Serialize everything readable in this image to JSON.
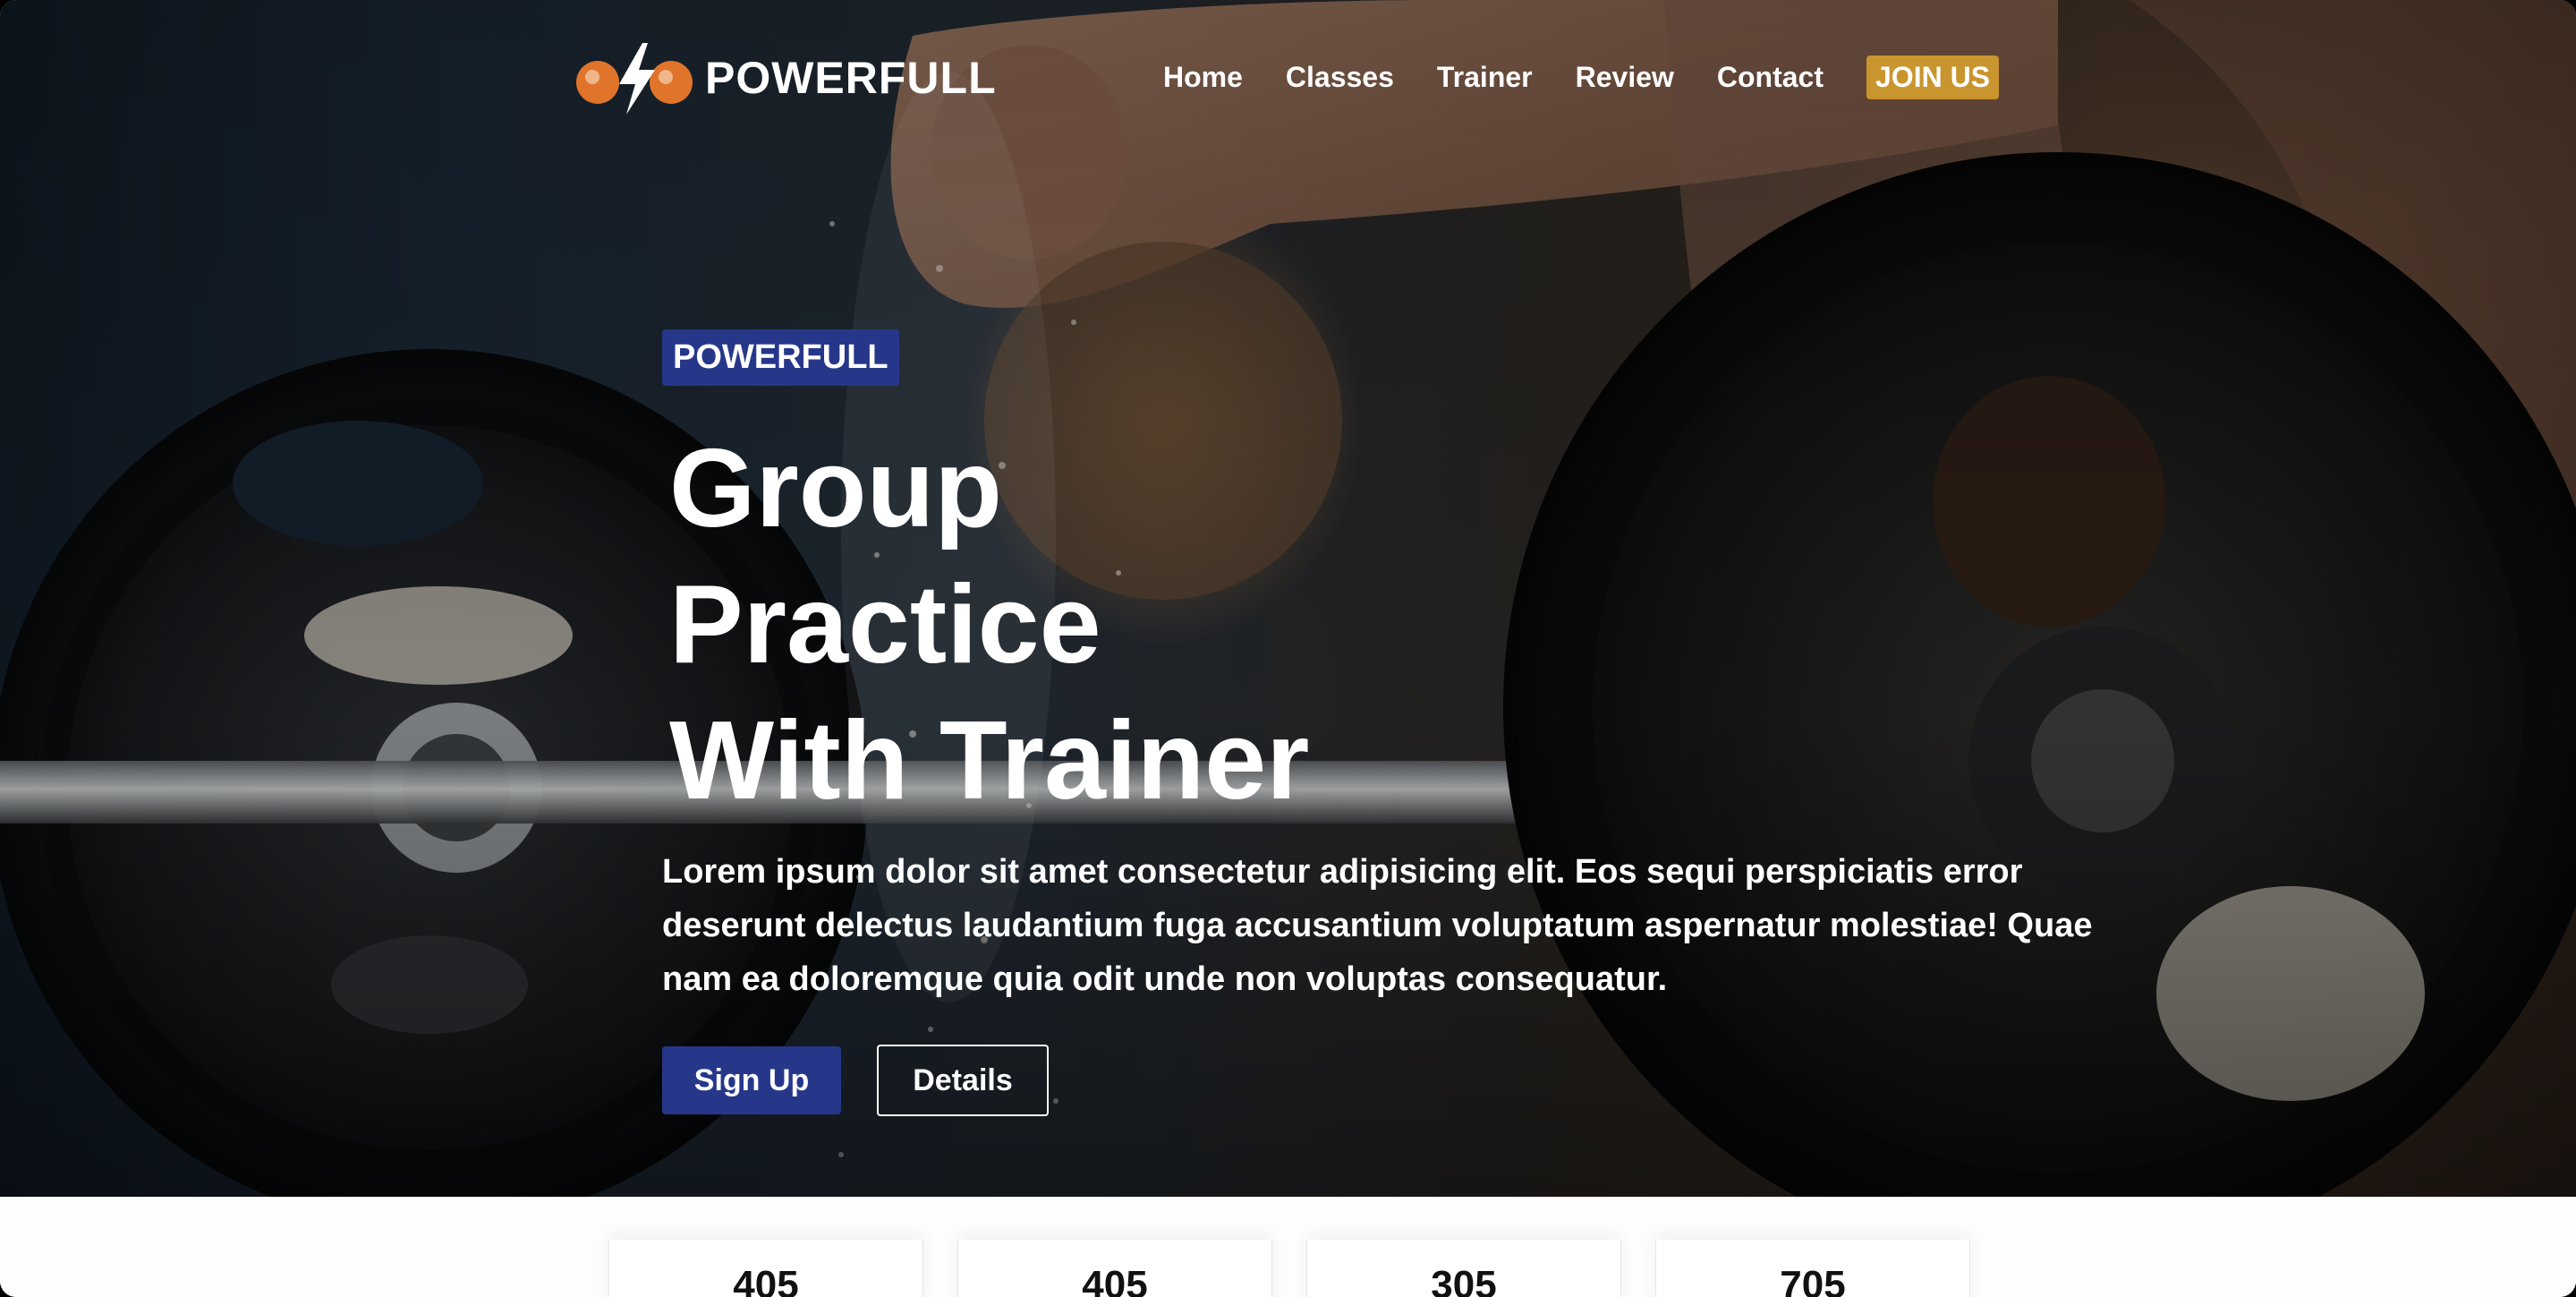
{
  "brand": {
    "name": "POWERFULL"
  },
  "nav": {
    "links": [
      "Home",
      "Classes",
      "Trainer",
      "Review",
      "Contact"
    ],
    "cta": "JOIN US"
  },
  "hero": {
    "badge": "POWERFULL",
    "headline": [
      "Group",
      "Practice",
      "With Trainer"
    ],
    "lead": "Lorem ipsum dolor sit amet consectetur adipisicing elit. Eos sequi perspiciatis error deserunt delectus laudantium fuga accusantium voluptatum aspernatur molestiae! Quae nam ea doloremque quia odit unde non voluptas consequatur.",
    "primary_button": "Sign Up",
    "secondary_button": "Details"
  },
  "stats": [
    {
      "value": "405"
    },
    {
      "value": "405"
    },
    {
      "value": "305"
    },
    {
      "value": "705"
    }
  ],
  "colors": {
    "accent_blue": "#26378a",
    "accent_gold": "#c9952e",
    "logo_orange": "#e0742b"
  }
}
